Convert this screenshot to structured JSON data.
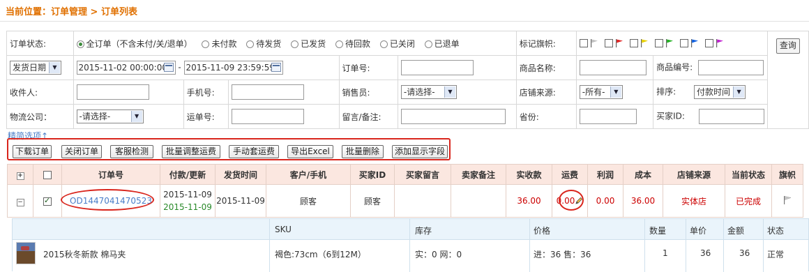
{
  "breadcrumb": "当前位置：订单管理 > 订单列表",
  "filters": {
    "status_label": "订单状态:",
    "status_options": [
      "全订单（不含未付/关/退单）",
      "未付款",
      "待发货",
      "已发货",
      "待回款",
      "已关闭",
      "已退单"
    ],
    "selected_status": "全订单（不含未付/关/退单）",
    "flag_label": "标记旗帜:",
    "flag_colors": [
      "#c0c0c0",
      "#e02020",
      "#e8d000",
      "#20b020",
      "#1060e0",
      "#c020d0"
    ],
    "date_type": "发货日期",
    "date_from": "2015-11-02 00:00:00",
    "date_to": "2015-11-09 23:59:59",
    "order_no_label": "订单号:",
    "product_name_label": "商品名称:",
    "product_code_label": "商品编号:",
    "query_button": "查询",
    "receiver_label": "收件人:",
    "phone_label": "手机号:",
    "salesman_label": "销售员:",
    "salesman_value": "-请选择-",
    "shop_source_label": "店铺来源:",
    "shop_source_value": "-所有-",
    "sort_label": "排序:",
    "sort_value": "付款时间",
    "logistics_label": "物流公司：",
    "logistics_value": "-请选择-",
    "tracking_label": "运单号:",
    "remark_label": "留言/备注:",
    "province_label": "省份:",
    "buyer_id_label": "买家ID:",
    "simplify_link": "精简选项↑"
  },
  "toolbar": {
    "buttons": [
      "下载订单",
      "关闭订单",
      "客服检测",
      "批量调整运费",
      "手动套运费",
      "导出Excel",
      "批量删除",
      "添加显示字段"
    ]
  },
  "orders": {
    "headers": [
      "订单号",
      "付款/更新",
      "发货时间",
      "客户/手机",
      "买家ID",
      "买家留言",
      "卖家备注",
      "实收款",
      "运费",
      "利润",
      "成本",
      "店铺来源",
      "当前状态",
      "旗帜"
    ],
    "row": {
      "order_no": "OD1447041470523",
      "pay_date": "2015-11-09",
      "update_date": "2015-11-09",
      "ship_date": "2015-11-09",
      "customer": "顾客",
      "buyer_id": "顾客",
      "received": "36.00",
      "shipping": "0.00",
      "profit": "0.00",
      "cost": "36.00",
      "shop_source": "实体店",
      "status": "已完成"
    }
  },
  "sku_table": {
    "headers": {
      "sku": "SKU",
      "stock": "库存",
      "price": "价格",
      "qty": "数量",
      "unit_price": "单价",
      "amount": "金额",
      "status": "状态"
    },
    "item": {
      "name": "2015秋冬新款 棉马夹",
      "sku": "褐色:73cm（6到12M）",
      "stock": "实：0  网：0",
      "price": "进：36  售：36",
      "qty": "1",
      "unit_price": "36",
      "amount": "36",
      "status": "正常"
    }
  }
}
